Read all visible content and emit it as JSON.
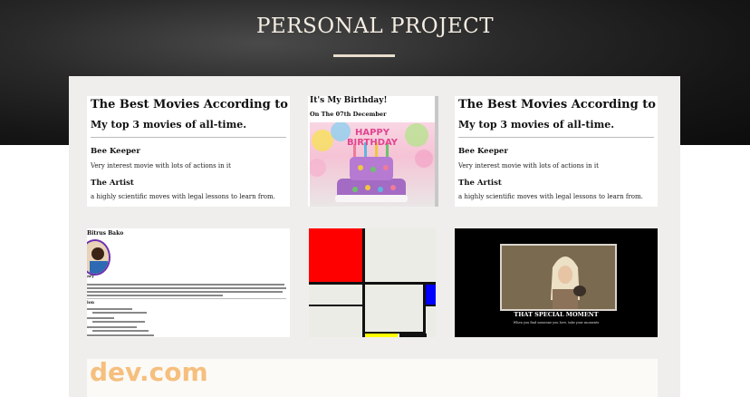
{
  "header": {
    "title": "PERSONAL PROJECT"
  },
  "projects": {
    "movies_left": {
      "title": "The Best Movies According to Andi",
      "subtitle": "My top 3 movies of all-time.",
      "item1_title": "Bee Keeper",
      "item1_text": "Very interest movie with lots of actions in it",
      "item2_title": "The Artist",
      "item2_text": "a highly scientific moves with legal lessons to learn from."
    },
    "birthday": {
      "title": "It's My Birthday!",
      "date": "On The 07th December",
      "cake_text": "HAPPY BIRTHDAY"
    },
    "movies_right": {
      "title": "The Best Movies According to Andi",
      "subtitle": "My top 3 movies of all-time.",
      "item1_title": "Bee Keeper",
      "item1_text": "Very interest movie with lots of actions in it",
      "item2_title": "The Artist",
      "item2_text": "a highly scientific moves with legal lessons to learn from."
    },
    "resume": {
      "name": "Bitrus Bako",
      "section1": "ary",
      "section2": "ion"
    },
    "mondrian": {
      "colors": [
        "#ff0000",
        "#0000ff",
        "#ffff00",
        "#111111"
      ]
    },
    "moment": {
      "caption": "THAT SPECIAL MOMENT",
      "subcaption": "When you find someone you love, take your moments"
    },
    "devcom": {
      "text": "dev.com"
    }
  }
}
